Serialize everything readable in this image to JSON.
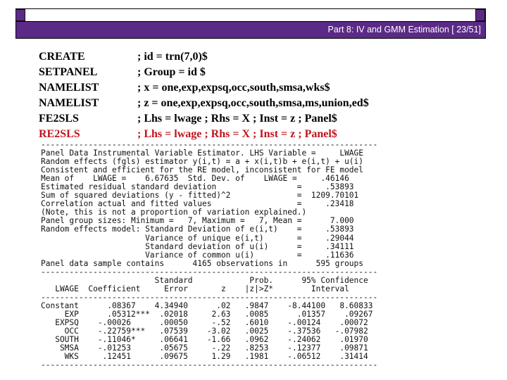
{
  "header": {
    "title": "Part 8: IV and GMM Estimation [ 23/51]"
  },
  "commands": [
    {
      "keyword": "CREATE",
      "args": "; id = trn(7,0)$",
      "highlight": false
    },
    {
      "keyword": "SETPANEL",
      "args": "; Group = id $",
      "highlight": false
    },
    {
      "keyword": "NAMELIST",
      "args": "; x = one,exp,expsq,occ,south,smsa,wks$",
      "highlight": false
    },
    {
      "keyword": "NAMELIST",
      "args": "; z = one,exp,expsq,occ,south,smsa,ms,union,ed$",
      "highlight": false
    },
    {
      "keyword": "FE2SLS",
      "args": "; Lhs = lwage ; Rhs = X ; Inst = z ; Panel$",
      "highlight": false
    },
    {
      "keyword": "RE2SLS",
      "args": "; Lhs = lwage ; Rhs = X ; Inst = z ; Panel$",
      "highlight": true
    }
  ],
  "colors": {
    "header_bg": "#5b2a86",
    "highlight": "#c0141c"
  },
  "output_lines": [
    "-----------------------------------------------------------------------",
    "Panel Data Instrumental Variable Estimator. LHS Variable =     LWAGE",
    "Random effects (fgls) estimator y(i,t) = a + x(i,t)b + e(i,t) + u(i)",
    "Consistent and efficient for the RE model, inconsistent for FE model",
    "Mean of    LWAGE =    6.67635  Std. Dev. of    LWAGE =     .46146",
    "Estimated residual standard deviation                 =     .53893",
    "Sum of squared deviations (y - fitted)^2              =  1209.70101",
    "Correlation actual and fitted values                  =     .23418",
    "(Note, this is not a proportion of variation explained.)",
    "Panel group sizes: Minimum =   7, Maximum =   7, Mean =      7.000",
    "Random effects model: Standard Deviation of e(i,t)    =     .53893",
    "                      Variance of unique e(i,t)       =     .29044",
    "                      Standard deviation of u(i)      =     .34111",
    "                      Variance of common u(i)         =     .11636",
    "Panel data sample contains      4165 observations in      595 groups",
    "-----------------------------------------------------------------------",
    "                        Standard            Prob.      95% Confidence",
    "   LWAGE  Coefficient     Error       z    |z|>Z*        Interval",
    "-----------------------------------------------------------------------",
    "Constant      .08367    4.34940      .02   .9847    -8.44100   8.60833",
    "     EXP      .05312***  .02018     2.63   .0085      .01357    .09267",
    "   EXPSQ    -.00026      .00050     -.52   .6010    -.00124    .00072",
    "     OCC    -.22759***   .07539    -3.02   .0025    -.37536   -.07982",
    "   SOUTH    -.11046*     .06641    -1.66   .0962    -.24062    .01970",
    "    SMSA    -.01253      .05675     -.22   .8253    -.12377    .09871",
    "     WKS     .12451      .09675     1.29   .1981    -.06512    .31414",
    "-----------------------------------------------------------------------"
  ]
}
